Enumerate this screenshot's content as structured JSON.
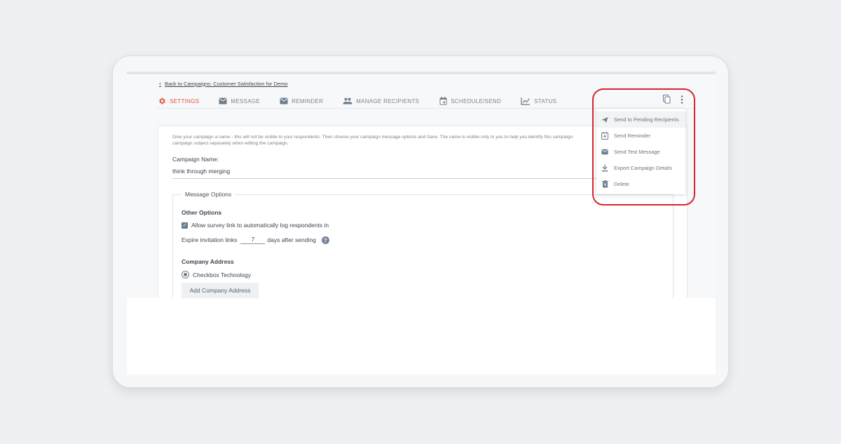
{
  "back_link": "Back to Campaigns: Customer Satisfaction for Demo",
  "tabs": [
    {
      "label": "SETTINGS",
      "icon": "gear-icon",
      "active": true
    },
    {
      "label": "MESSAGE",
      "icon": "envelope-icon"
    },
    {
      "label": "REMINDER",
      "icon": "envelope-icon"
    },
    {
      "label": "MANAGE RECIPIENTS",
      "icon": "people-icon"
    },
    {
      "label": "SCHEDULE/SEND",
      "icon": "calendar-icon"
    },
    {
      "label": "STATUS",
      "icon": "trend-chart-icon"
    }
  ],
  "top_icons": [
    "copy-icon",
    "more-vertical-icon"
  ],
  "settings": {
    "intro": "Give your campaign a name - this will not be visible to your respondents. Then choose your campaign message options and Save. The name is visible only to you to help you identify this campaign",
    "intro_line2": "campaign subject separately when editing the campaign.",
    "name_label": "Campaign Name:",
    "name_value": "think through merging",
    "message_options": {
      "legend": "Message Options",
      "other_options_title": "Other Options",
      "auto_login_label": "Allow survey link to automatically log respondents in",
      "auto_login_checked": true,
      "expire_prefix": "Expire invitation links",
      "expire_days": "7",
      "expire_suffix": "days after sending",
      "company_address_title": "Company Address",
      "company_address_option": "Checkbox Technology",
      "add_address_button": "Add Company Address"
    }
  },
  "menu": {
    "items": [
      {
        "label": "Send to Pending Recipients",
        "icon": "paper-plane-icon"
      },
      {
        "label": "Send Reminder",
        "icon": "calendar-add-icon"
      },
      {
        "label": "Send Test Message",
        "icon": "envelope-icon"
      },
      {
        "label": "Export Campaign Details",
        "icon": "download-icon"
      },
      {
        "label": "Delete",
        "icon": "trash-icon"
      }
    ]
  },
  "colors": {
    "accent": "#e5533d",
    "annotation": "#d6262f",
    "icon": "#6d7d8c"
  }
}
